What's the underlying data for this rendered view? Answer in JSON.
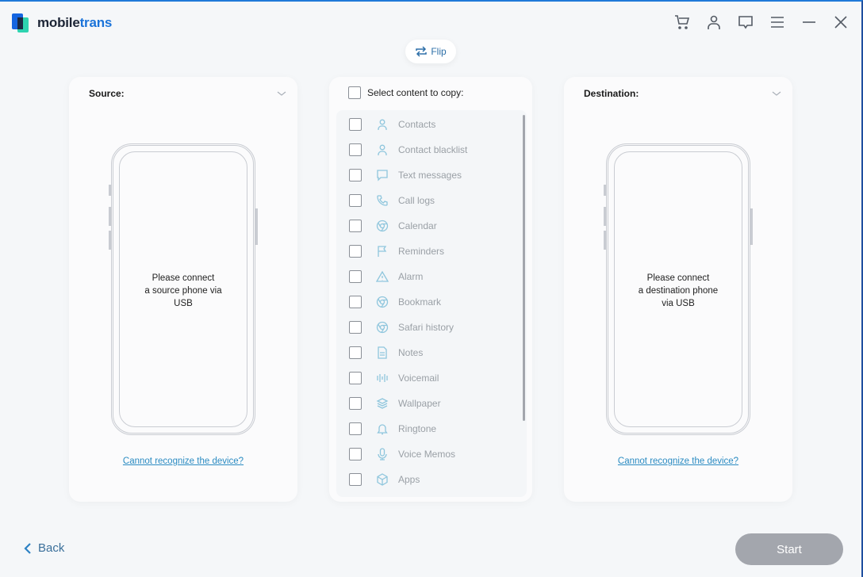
{
  "app": {
    "logo_part1": "mobile",
    "logo_part2": "trans"
  },
  "header": {
    "icons": [
      "cart-icon",
      "user-icon",
      "feedback-icon",
      "menu-icon",
      "minimize-icon",
      "close-icon"
    ]
  },
  "flip": {
    "label": "Flip"
  },
  "source": {
    "title": "Source:",
    "message_line1": "Please connect",
    "message_line2": "a source phone via",
    "message_line3": "USB",
    "link": "Cannot recognize the device?"
  },
  "destination": {
    "title": "Destination:",
    "message_line1": "Please connect",
    "message_line2": "a destination phone",
    "message_line3": "via USB",
    "link": "Cannot recognize the device?"
  },
  "content": {
    "select_all_label": "Select content to copy:",
    "items": [
      {
        "label": "Contacts",
        "icon": "person"
      },
      {
        "label": "Contact blacklist",
        "icon": "person"
      },
      {
        "label": "Text messages",
        "icon": "message"
      },
      {
        "label": "Call logs",
        "icon": "phone"
      },
      {
        "label": "Calendar",
        "icon": "browser"
      },
      {
        "label": "Reminders",
        "icon": "flag"
      },
      {
        "label": "Alarm",
        "icon": "warning"
      },
      {
        "label": "Bookmark",
        "icon": "browser"
      },
      {
        "label": "Safari history",
        "icon": "browser"
      },
      {
        "label": "Notes",
        "icon": "note"
      },
      {
        "label": "Voicemail",
        "icon": "voicemail"
      },
      {
        "label": "Wallpaper",
        "icon": "layers"
      },
      {
        "label": "Ringtone",
        "icon": "bell"
      },
      {
        "label": "Voice Memos",
        "icon": "mic"
      },
      {
        "label": "Apps",
        "icon": "cube"
      }
    ]
  },
  "footer": {
    "back_label": "Back",
    "start_label": "Start"
  }
}
